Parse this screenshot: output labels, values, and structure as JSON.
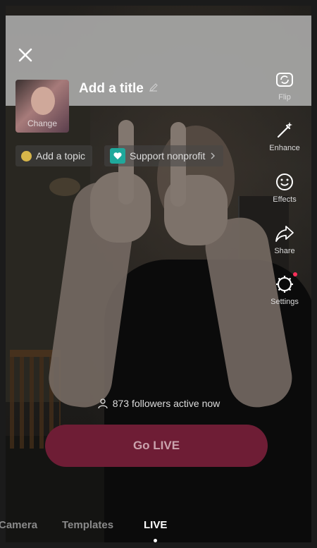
{
  "top": {
    "cover_label": "Change",
    "title_placeholder": "Add a title"
  },
  "chips": {
    "topic": "Add a topic",
    "nonprofit": "Support nonprofit"
  },
  "tools": [
    {
      "label": "Flip",
      "icon": "flip-camera-icon"
    },
    {
      "label": "Enhance",
      "icon": "magic-wand-icon"
    },
    {
      "label": "Effects",
      "icon": "smiley-icon"
    },
    {
      "label": "Share",
      "icon": "share-arrow-icon"
    },
    {
      "label": "Settings",
      "icon": "gear-icon"
    }
  ],
  "live": {
    "followers_text": "873 followers active now",
    "go_live_label": "Go LIVE"
  },
  "modes": {
    "camera": "Camera",
    "templates": "Templates",
    "live": "LIVE",
    "selected": "LIVE"
  },
  "colors": {
    "go_live_bg": "#6e1d35",
    "accent_dot": "#ff2f5a",
    "nonprofit_icon": "#1fa89b"
  }
}
